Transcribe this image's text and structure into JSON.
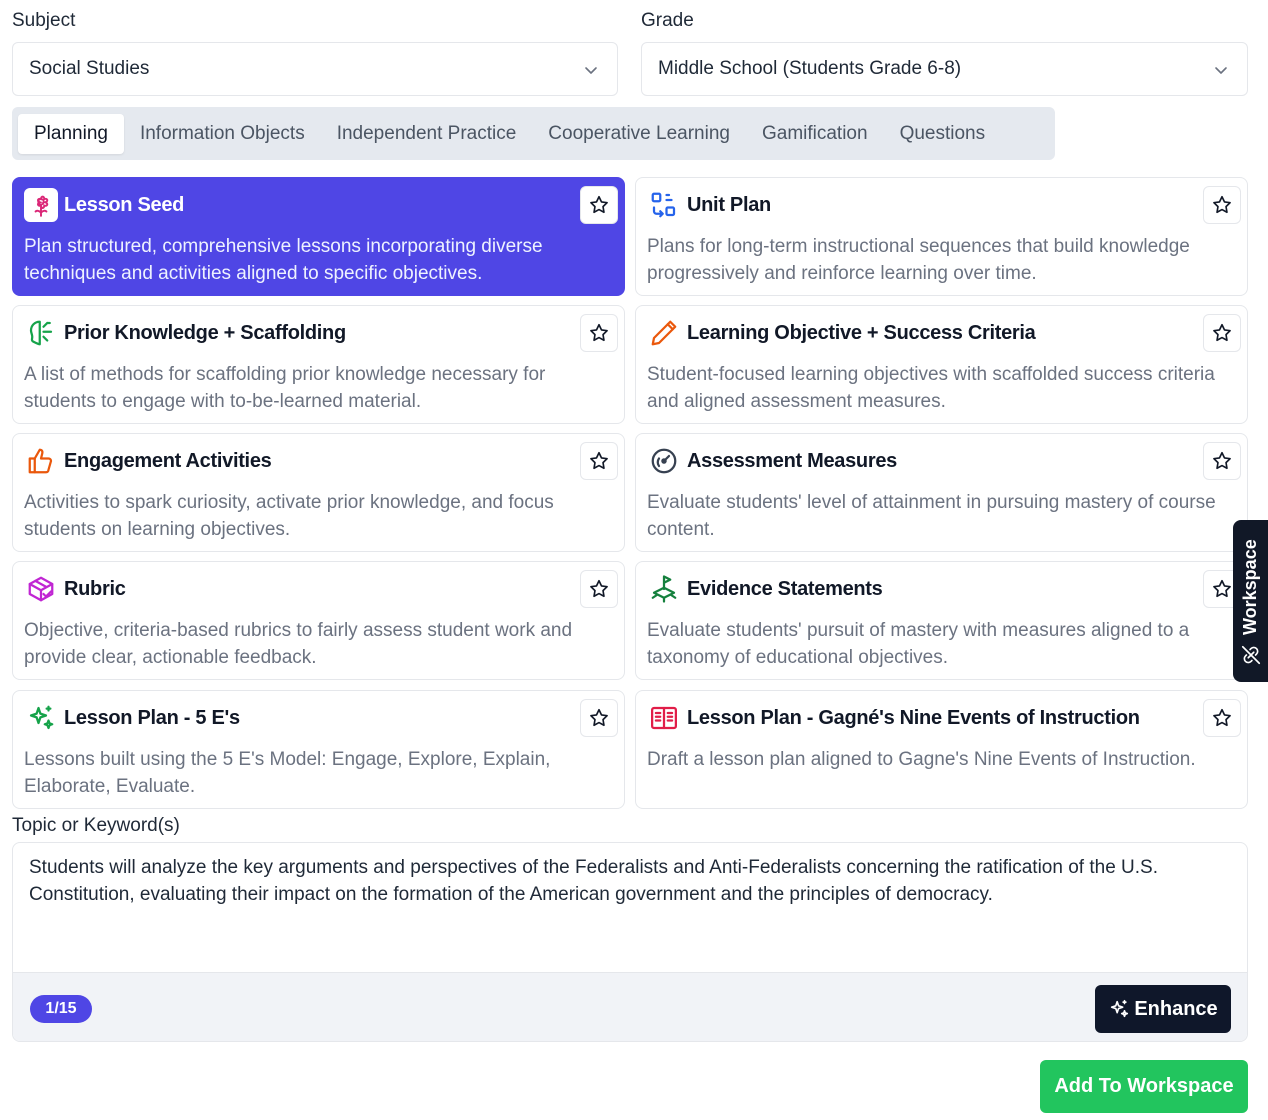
{
  "subject": {
    "label": "Subject",
    "value": "Social Studies"
  },
  "grade": {
    "label": "Grade",
    "value": "Middle School (Students Grade 6-8)"
  },
  "tabs": [
    {
      "label": "Planning",
      "active": true
    },
    {
      "label": "Information Objects"
    },
    {
      "label": "Independent Practice"
    },
    {
      "label": "Cooperative Learning"
    },
    {
      "label": "Gamification"
    },
    {
      "label": "Questions"
    }
  ],
  "cards": [
    {
      "title": "Lesson Seed",
      "icon": "flower-icon",
      "selected": true,
      "desc": "Plan structured, comprehensive lessons incorporating diverse techniques and activities aligned to specific objectives."
    },
    {
      "title": "Unit Plan",
      "icon": "unit-plan-icon",
      "desc": "Plans for long-term instructional sequences that build knowledge progressively and reinforce learning over time."
    },
    {
      "title": "Prior Knowledge + Scaffolding",
      "icon": "brain-icon",
      "desc": "A list of methods for scaffolding prior knowledge necessary for students to engage with to-be-learned material."
    },
    {
      "title": "Learning Objective + Success Criteria",
      "icon": "pencil-icon",
      "desc": "Student-focused learning objectives with scaffolded success criteria and aligned assessment measures."
    },
    {
      "title": "Engagement Activities",
      "icon": "thumbs-up-icon",
      "desc": "Activities to spark curiosity, activate prior knowledge, and focus students on learning objectives."
    },
    {
      "title": "Assessment Measures",
      "icon": "gauge-icon",
      "desc": "Evaluate students' level of attainment in pursuing mastery of course content."
    },
    {
      "title": "Rubric",
      "icon": "package-check-icon",
      "desc": "Objective, criteria-based rubrics to fairly assess student work and provide clear, actionable feedback."
    },
    {
      "title": "Evidence Statements",
      "icon": "waypoints-icon",
      "desc": "Evaluate students' pursuit of mastery with measures aligned to a taxonomy of educational objectives."
    },
    {
      "title": "Lesson Plan - 5 E's",
      "icon": "sparkles-icon",
      "desc": "Lessons built using the 5 E's Model: Engage, Explore, Explain, Elaborate, Evaluate."
    },
    {
      "title": "Lesson Plan - Gagné's Nine Events of Instruction",
      "icon": "book-open-icon",
      "desc": "Draft a lesson plan aligned to Gagne's Nine Events of Instruction."
    }
  ],
  "topic": {
    "label": "Topic or Keyword(s)",
    "value": "Students will analyze the key arguments and perspectives of the Federalists and Anti-Federalists concerning the ratification of the U.S. Constitution, evaluating their impact on the formation of the American government and the principles of democracy.",
    "counter": "1/15",
    "enhance_label": "Enhance"
  },
  "add_button": "Add To Workspace",
  "workspace_tab": "Workspace",
  "colors": {
    "accent": "#4f46e5",
    "success": "#22c55e",
    "dark": "#0f172a"
  }
}
